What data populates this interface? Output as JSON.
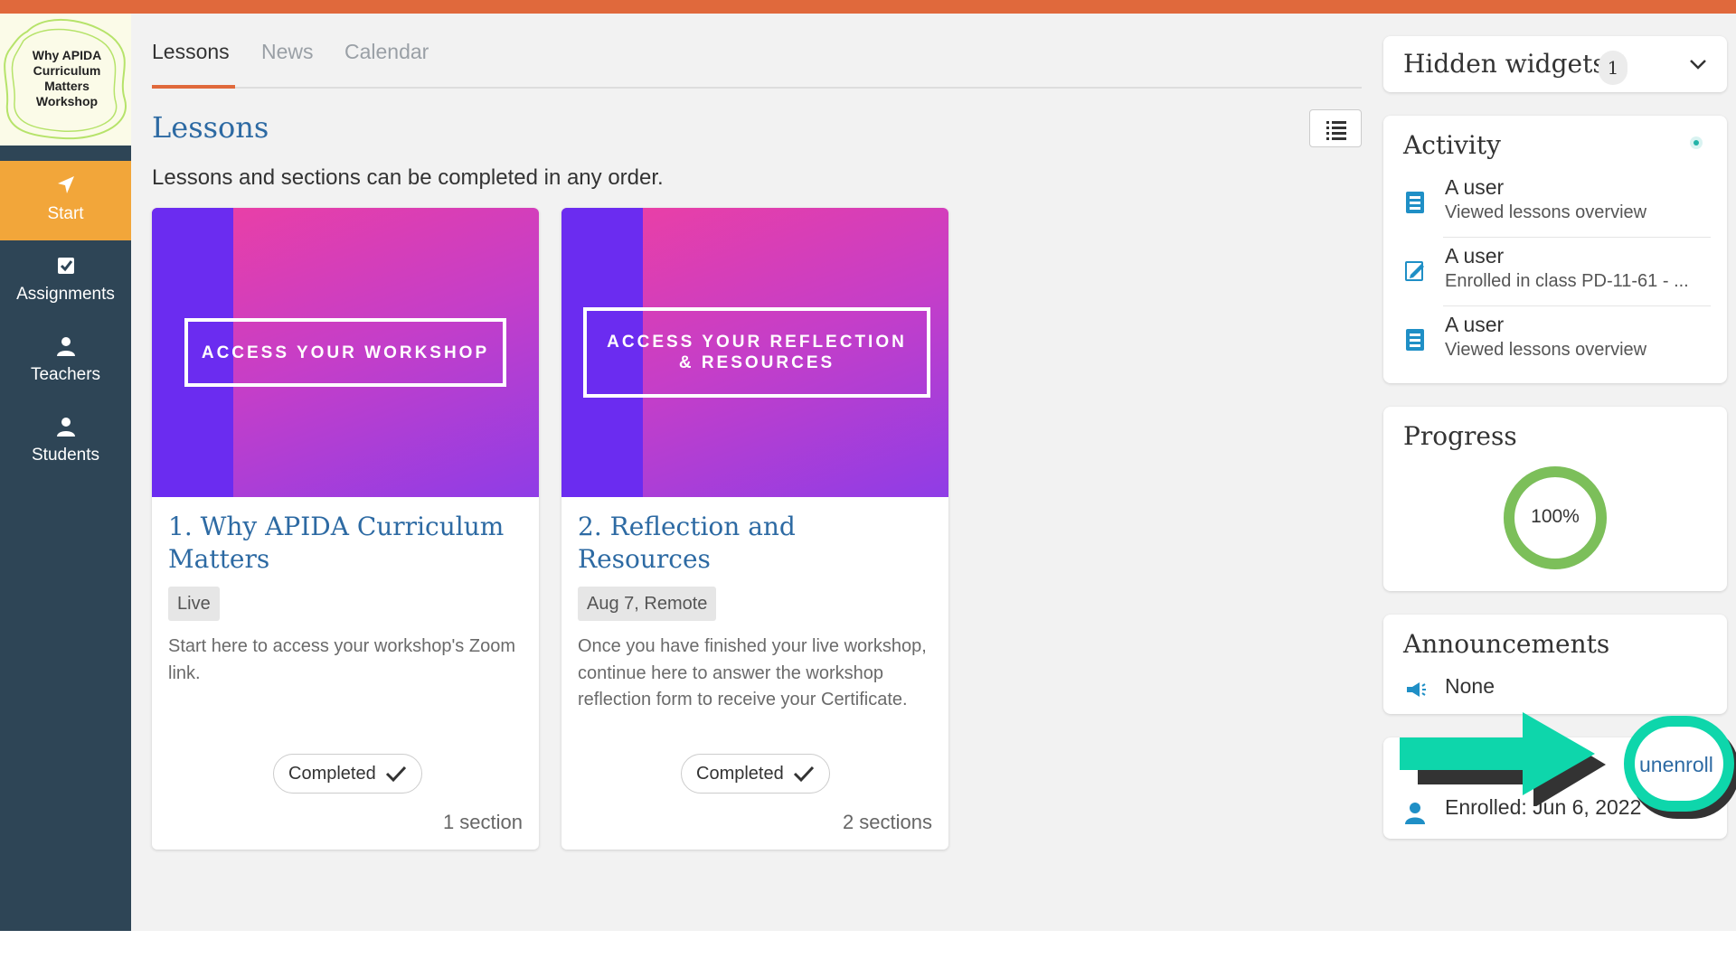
{
  "sidebar": {
    "logo_lines": [
      "Why APIDA",
      "Curriculum",
      "Matters",
      "Workshop"
    ],
    "items": [
      {
        "label": "Start",
        "icon": "navigation-arrow-icon",
        "active": true
      },
      {
        "label": "Assignments",
        "icon": "checkbox-icon",
        "active": false
      },
      {
        "label": "Teachers",
        "icon": "person-icon",
        "active": false
      },
      {
        "label": "Students",
        "icon": "person-icon",
        "active": false
      }
    ]
  },
  "tabs": [
    {
      "label": "Lessons",
      "active": true
    },
    {
      "label": "News",
      "active": false
    },
    {
      "label": "Calendar",
      "active": false
    }
  ],
  "page": {
    "title": "Lessons",
    "subtitle": "Lessons and sections can be completed in any order."
  },
  "lessons": [
    {
      "banner_text": "ACCESS YOUR WORKSHOP",
      "title": "1. Why APIDA Curriculum Matters",
      "tag": "Live",
      "description": "Start here to access your workshop's Zoom link.",
      "status": "Completed",
      "sections": "1 section"
    },
    {
      "banner_line1": "ACCESS YOUR REFLECTION",
      "banner_line2": "& RESOURCES",
      "title": "2. Reflection and Resources",
      "tag": "Aug 7, Remote",
      "description": "Once you have finished your live workshop, continue here to answer the workshop reflection form to receive your Certificate.",
      "status": "Completed",
      "sections": "2 sections"
    }
  ],
  "hidden_widgets": {
    "label": "Hidden widgets",
    "count": "1"
  },
  "activity": {
    "title": "Activity",
    "items": [
      {
        "who": "A user",
        "what": "Viewed lessons overview",
        "icon": "book-icon"
      },
      {
        "who": "A user",
        "what": "Enrolled in class PD-11-61 - ...",
        "icon": "enroll-edit-icon"
      },
      {
        "who": "A user",
        "what": "Viewed lessons overview",
        "icon": "book-icon"
      }
    ]
  },
  "progress": {
    "title": "Progress",
    "value_label": "100%",
    "fraction": 1.0
  },
  "announcements": {
    "title": "Announcements",
    "value": "None"
  },
  "enrollment": {
    "action": "unenroll",
    "enrolled": "Enrolled: Jun 6, 2022"
  },
  "colors": {
    "accent": "#e0693c",
    "sidebar": "#2e4556",
    "active_nav": "#f2a63a",
    "link": "#2d6aa3",
    "highlight": "#0ed6ab",
    "progress": "#7cbf5a"
  }
}
